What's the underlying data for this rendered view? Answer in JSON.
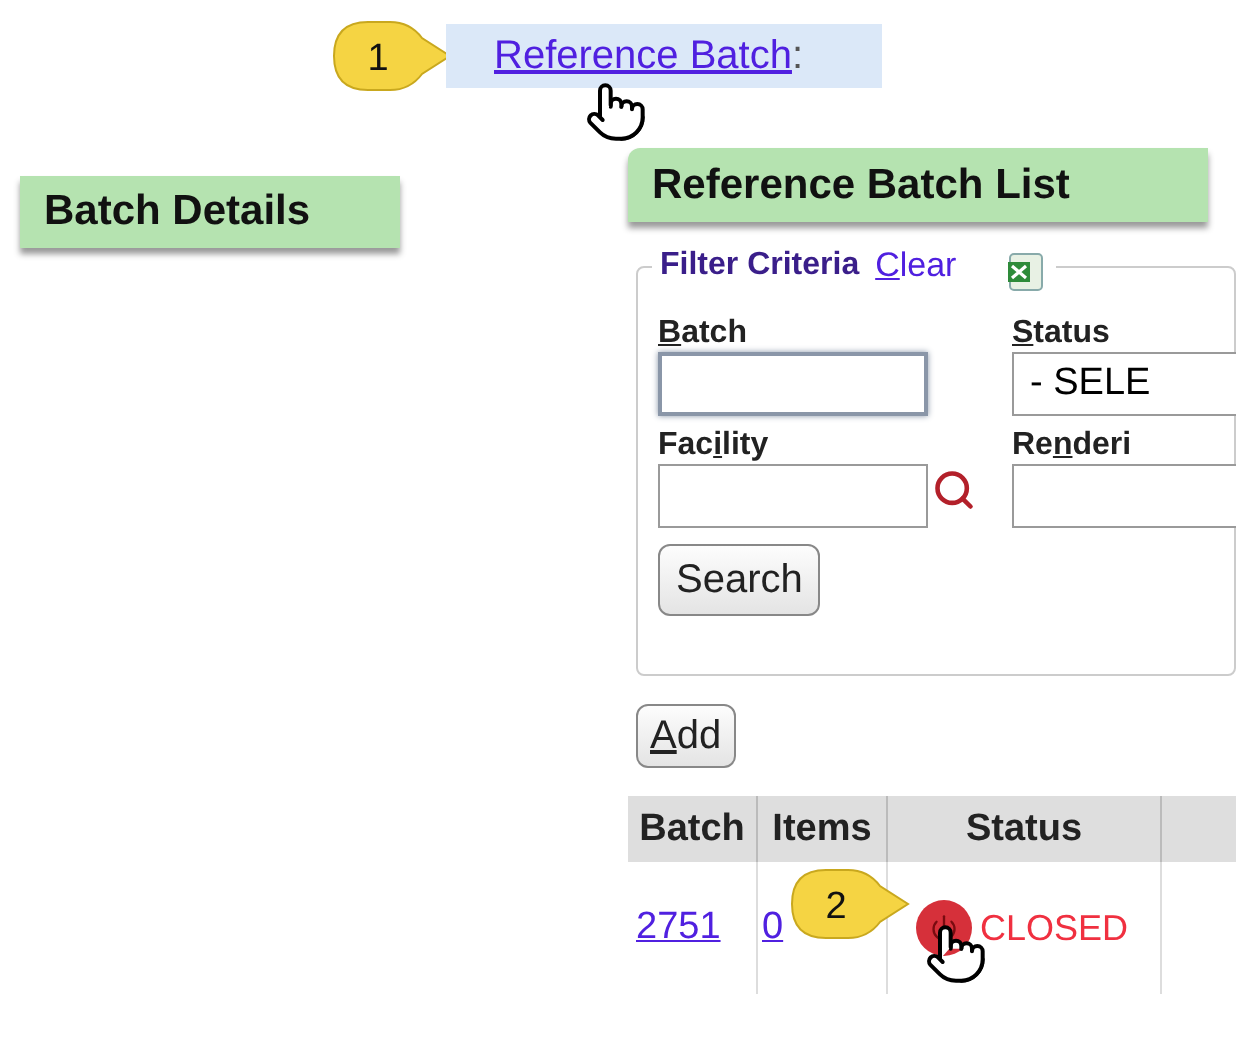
{
  "link_bar": {
    "callout": "1",
    "link": "Reference Batch",
    "suffix": ":"
  },
  "batch_details": {
    "title": "Batch Details"
  },
  "reference_batch_list": {
    "title": "Reference Batch List",
    "filter": {
      "legend": "Filter Criteria",
      "clear": {
        "key": "C",
        "after": "lear"
      },
      "fields": [
        {
          "kind": "text",
          "label": {
            "key": "B",
            "after": "atch"
          },
          "focused": true
        },
        {
          "kind": "select",
          "label": {
            "key": "S",
            "after": "tatus"
          },
          "value": "- SELE"
        },
        {
          "kind": "lookup",
          "label": {
            "before": "Fac",
            "key": "i",
            "after": "lity"
          },
          "focused": false
        },
        {
          "kind": "text",
          "label": {
            "before": "Re",
            "key": "n",
            "after": "deri"
          },
          "focused": false
        }
      ],
      "search_button": "Search"
    },
    "add_button": {
      "key": "A",
      "after": "dd"
    },
    "table": {
      "columns": [
        "Batch",
        "Items",
        "Status"
      ],
      "rows": [
        {
          "batch": "2751",
          "items": "0",
          "status": "CLOSED",
          "callout": "2"
        }
      ]
    }
  }
}
